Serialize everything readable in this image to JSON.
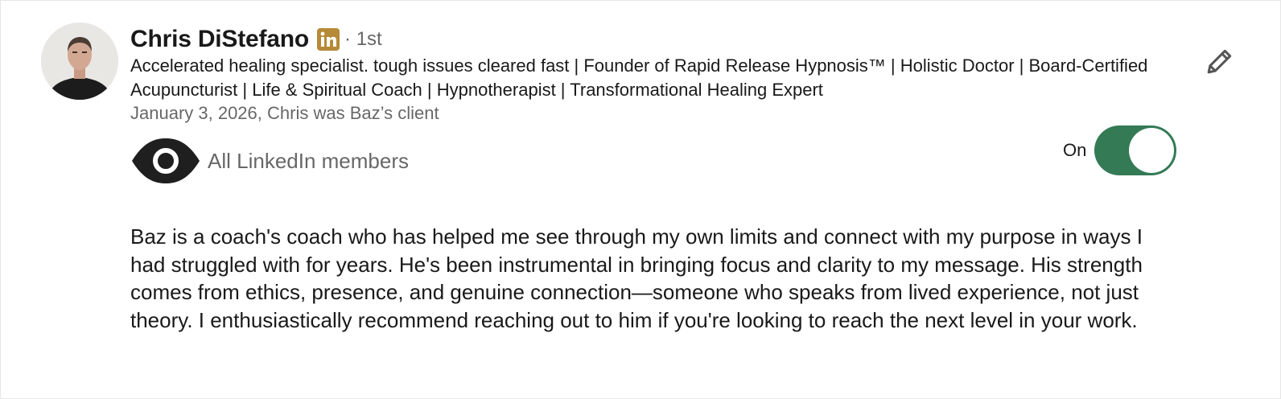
{
  "recommender": {
    "name": "Chris DiStefano",
    "badge_icon": "linkedin-icon",
    "degree": "· 1st",
    "headline": "Accelerated healing specialist. tough issues cleared fast | Founder of Rapid Release Hypnosis™ | Holistic Doctor | Board-Certified Acupuncturist | Life & Spiritual Coach | Hypnotherapist | Transformational Healing Expert",
    "relationship": "January 3, 2026, Chris was Baz’s client"
  },
  "visibility": {
    "icon": "eye-icon",
    "label": "All LinkedIn members"
  },
  "toggle": {
    "label": "On",
    "state": true,
    "color": "#347a55"
  },
  "edit": {
    "icon": "pencil-icon"
  },
  "recommendation": {
    "text": "Baz is a coach's coach who has helped me see through my own limits and connect with my purpose in ways I had struggled with for years. He's been instrumental in bringing focus and clarity to my message. His strength comes from ethics, presence, and genuine connection—someone who speaks from lived experience, not just theory. I enthusiastically recommend reaching out to him if you're looking to reach the next level in your work."
  },
  "colors": {
    "badge": "#b68a36",
    "text_primary": "rgba(0,0,0,0.9)",
    "text_secondary": "rgba(0,0,0,0.6)"
  }
}
